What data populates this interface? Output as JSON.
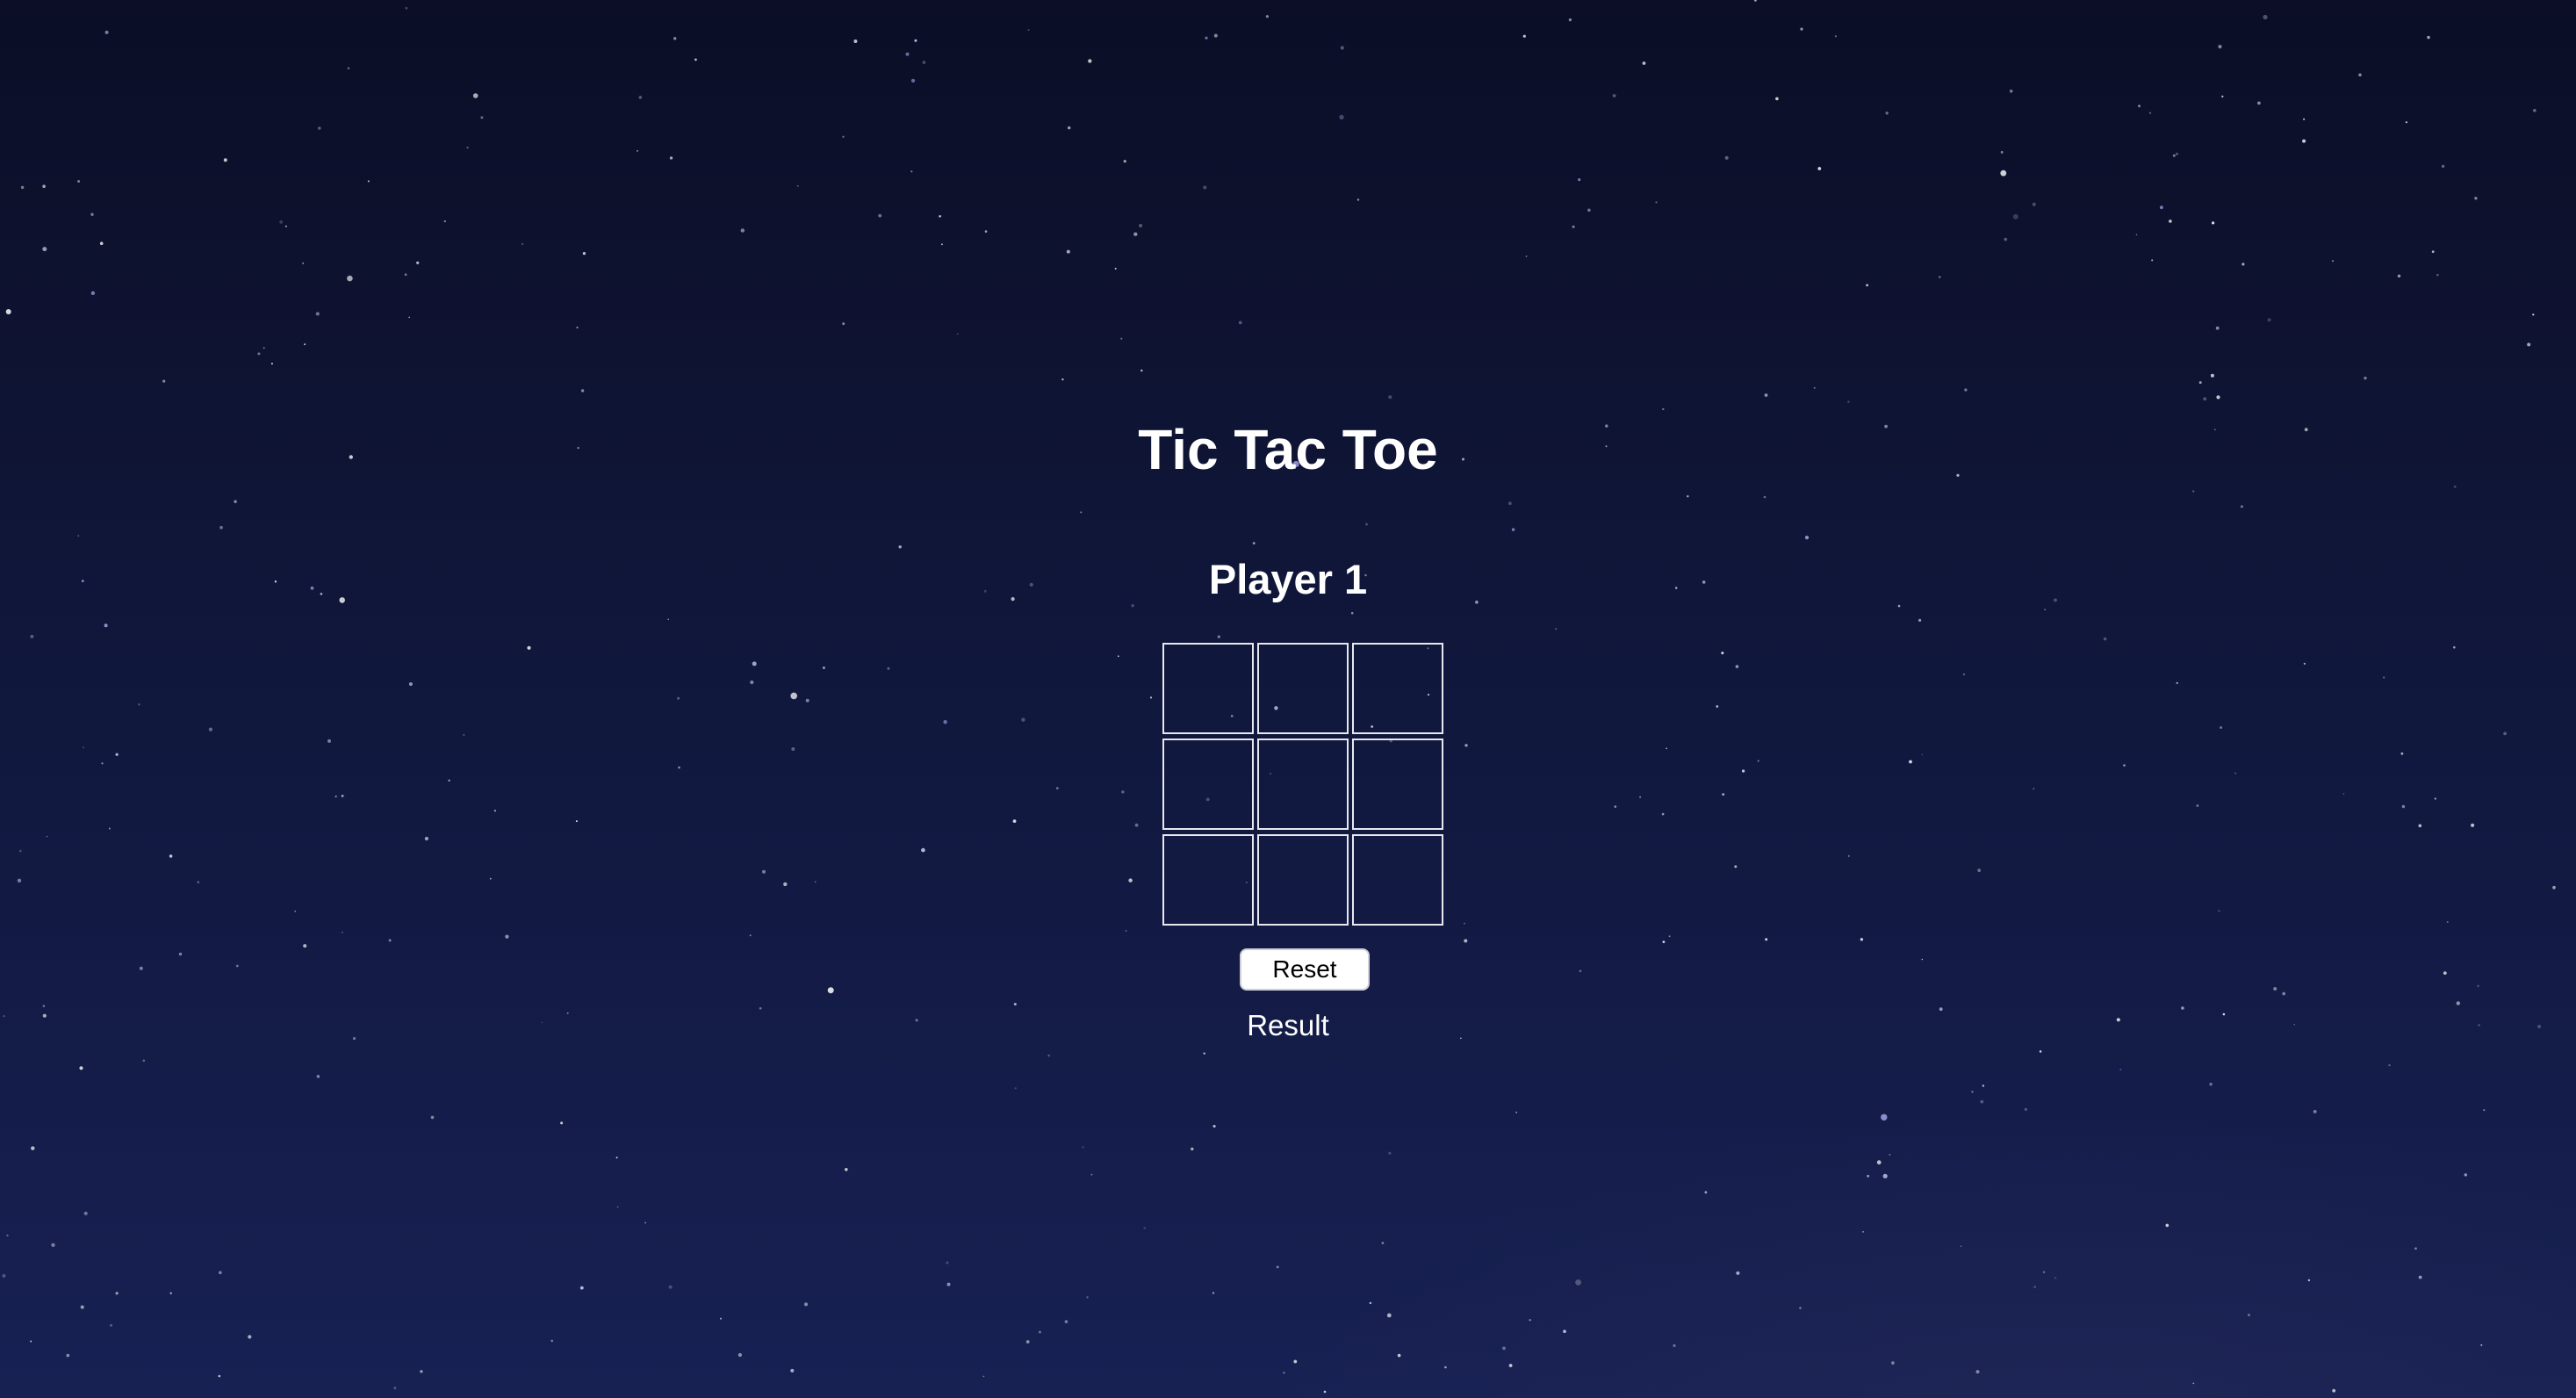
{
  "game": {
    "title": "Tic Tac Toe",
    "current_player": "Player 1",
    "board": [
      [
        "",
        "",
        ""
      ],
      [
        "",
        "",
        ""
      ],
      [
        "",
        "",
        ""
      ]
    ],
    "reset_label": "Reset",
    "result_text": "Result"
  },
  "colors": {
    "background_top": "#0b0e26",
    "background_bottom": "#172153",
    "text": "#ffffff",
    "cell_border": "#e8e8ee",
    "button_background": "#ffffff",
    "button_text": "#000000"
  },
  "background": {
    "description": "night sky with scattered stars"
  }
}
